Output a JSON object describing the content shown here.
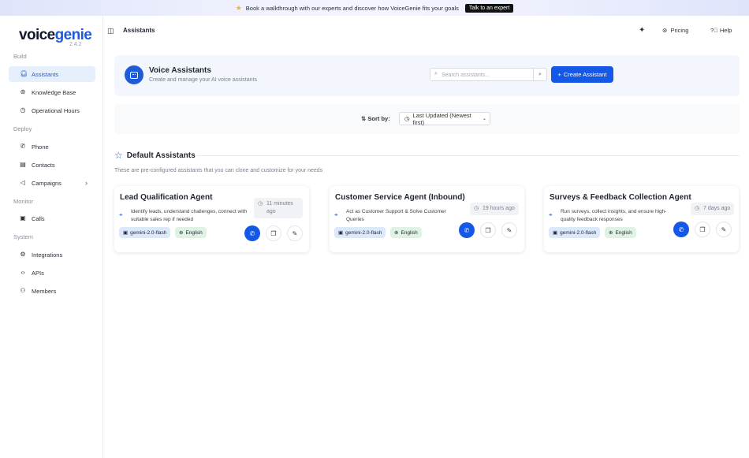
{
  "banner": {
    "text": "Book a walkthrough with our experts and discover how VoiceGenie fits your goals",
    "cta": "Talk to an expert"
  },
  "sidebar": {
    "logo": "voicegenie",
    "version": "2.4.2",
    "sections": [
      "Build",
      "Deploy",
      "Monitor",
      "System"
    ],
    "items": [
      {
        "label": "Assistants",
        "icon": "headset-icon",
        "active": true
      },
      {
        "label": "Knowledge Base",
        "icon": "book-icon"
      },
      {
        "label": "Operational Hours",
        "icon": "clock-icon"
      },
      {
        "label": "Phone",
        "icon": "phone-icon"
      },
      {
        "label": "Contacts",
        "icon": "contacts-icon"
      },
      {
        "label": "Campaigns",
        "icon": "megaphone-icon",
        "has_submenu": true
      },
      {
        "label": "Calls",
        "icon": "calls-icon"
      },
      {
        "label": "Integrations",
        "icon": "integrations-icon"
      },
      {
        "label": "APIs",
        "icon": "code-icon"
      },
      {
        "label": "Members",
        "icon": "members-icon"
      }
    ]
  },
  "topbar": {
    "title": "Assistants",
    "pricing": "Pricing",
    "help": "Help"
  },
  "header": {
    "title": "Voice Assistants",
    "subtitle": "Create and manage your AI voice assistants",
    "search_placeholder": "Search assistants...",
    "create_label": "Create Assistant"
  },
  "sort": {
    "label": "Sort by:",
    "value": "Last Updated (Newest first)"
  },
  "default_section": {
    "title": "Default Assistants",
    "description": "These are pre-configured assistants that you can clone and customize for your needs"
  },
  "assistants": [
    {
      "name": "Lead Qualification Agent",
      "time": "11 minutes ago",
      "description": "Identify leads, understand challenges, connect with suitable sales rep if needed",
      "model": "gemini-2.0-flash",
      "language": "English"
    },
    {
      "name": "Customer Service Agent (Inbound)",
      "time": "19 hours ago",
      "description": "Act as Customer Support & Solve Customer Queries",
      "model": "gemini-2.0-flash",
      "language": "English"
    },
    {
      "name": "Surveys & Feedback Collection Agent",
      "time": "7 days ago",
      "description": "Run surveys, collect insights, and ensure high-quality feedback responses",
      "model": "gemini-2.0-flash",
      "language": "English"
    }
  ],
  "colors": {
    "accent": "#1557e6",
    "active_nav_bg": "#e6f0fd",
    "model_tag_bg": "#dce8fb",
    "lang_tag_bg": "#dff3e5"
  }
}
